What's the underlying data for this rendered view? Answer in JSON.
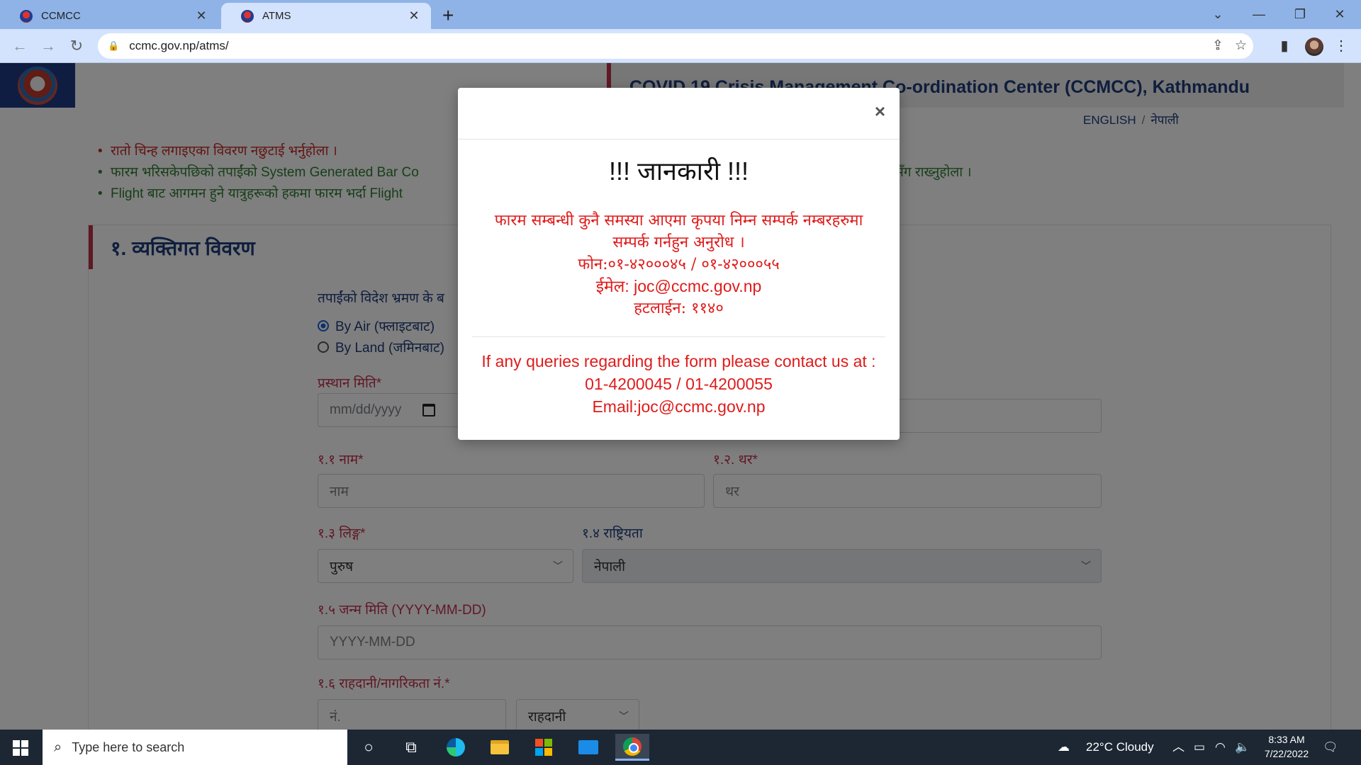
{
  "browser": {
    "tabs": [
      {
        "title": "CCMCC",
        "active": false
      },
      {
        "title": "ATMS",
        "active": true
      }
    ],
    "url": "ccmc.gov.np/atms/"
  },
  "site": {
    "header_title": "COVID 19 Crisis Management Co-ordination Center (CCMCC), Kathmandu",
    "lang_english": "ENGLISH",
    "lang_separator": "/",
    "lang_nepali": "नेपाली"
  },
  "notes": [
    {
      "text": "रातो चिन्ह लगाइएका विवरण नछुटाई भर्नुहोला ।",
      "color": "red"
    },
    {
      "text": "फारम भरिसकेपछिको तपाईंको System Generated Bar Co",
      "color": "green"
    },
    {
      "text": "Flight बाट आगमन हुने यात्रुहरूको हकमा फारम भर्दा Flight",
      "color": "green"
    }
  ],
  "note_right": "सँग राख्नुहोला ।",
  "form": {
    "section_title": "१. व्यक्तिगत विवरण",
    "travel_question": "तपाईंको विदेश भ्रमण के ब",
    "travel_options": [
      {
        "label": "By Air (फ्लाइटबाट)",
        "checked": true
      },
      {
        "label": "By Land (जमिनबाट)",
        "checked": false
      }
    ],
    "departure_date_label": "प्रस्थान मिति*",
    "departure_date_placeholder": "mm/dd/yyyy",
    "first_name_label": "१.१ नाम*",
    "first_name_placeholder": "नाम",
    "last_name_label": "१.२. थर*",
    "last_name_placeholder": "थर",
    "gender_label": "१.३ लिङ्ग*",
    "gender_value": "पुरुष",
    "nationality_label": "१.४ राष्ट्रियता",
    "nationality_value": "नेपाली",
    "dob_label": "१.५ जन्म मिति (YYYY-MM-DD)",
    "dob_placeholder": "YYYY-MM-DD",
    "passport_label": "१.६ राहदानी/नागरिकता नं.*",
    "passport_placeholder": "नं.",
    "id_type_value": "राहदानी"
  },
  "modal": {
    "close": "×",
    "title": "!!! जानकारी !!!",
    "np_line1": "फारम सम्बन्धी कुनै समस्या आएमा कृपया निम्न सम्पर्क नम्बरहरुमा",
    "np_line2": "सम्पर्क गर्नहुन अनुरोध ।",
    "np_phone": "फोन:०१-४२०००४५ / ०१-४२०००५५",
    "np_email": "ईमेल: joc@ccmc.gov.np",
    "np_hotline": "हटलाईन: ११४०",
    "en_line1": "If any queries regarding the form please contact us at :",
    "en_phone": "01-4200045 / 01-4200055",
    "en_email": "Email:joc@ccmc.gov.np"
  },
  "taskbar": {
    "search_placeholder": "Type here to search",
    "weather": "22°C  Cloudy",
    "time": "8:33 AM",
    "date": "7/22/2022"
  },
  "colors": {
    "header_navy": "#1e3c7a",
    "accent_red": "#c0304a",
    "modal_red": "#e01b1b",
    "note_green": "#2e7d32"
  }
}
